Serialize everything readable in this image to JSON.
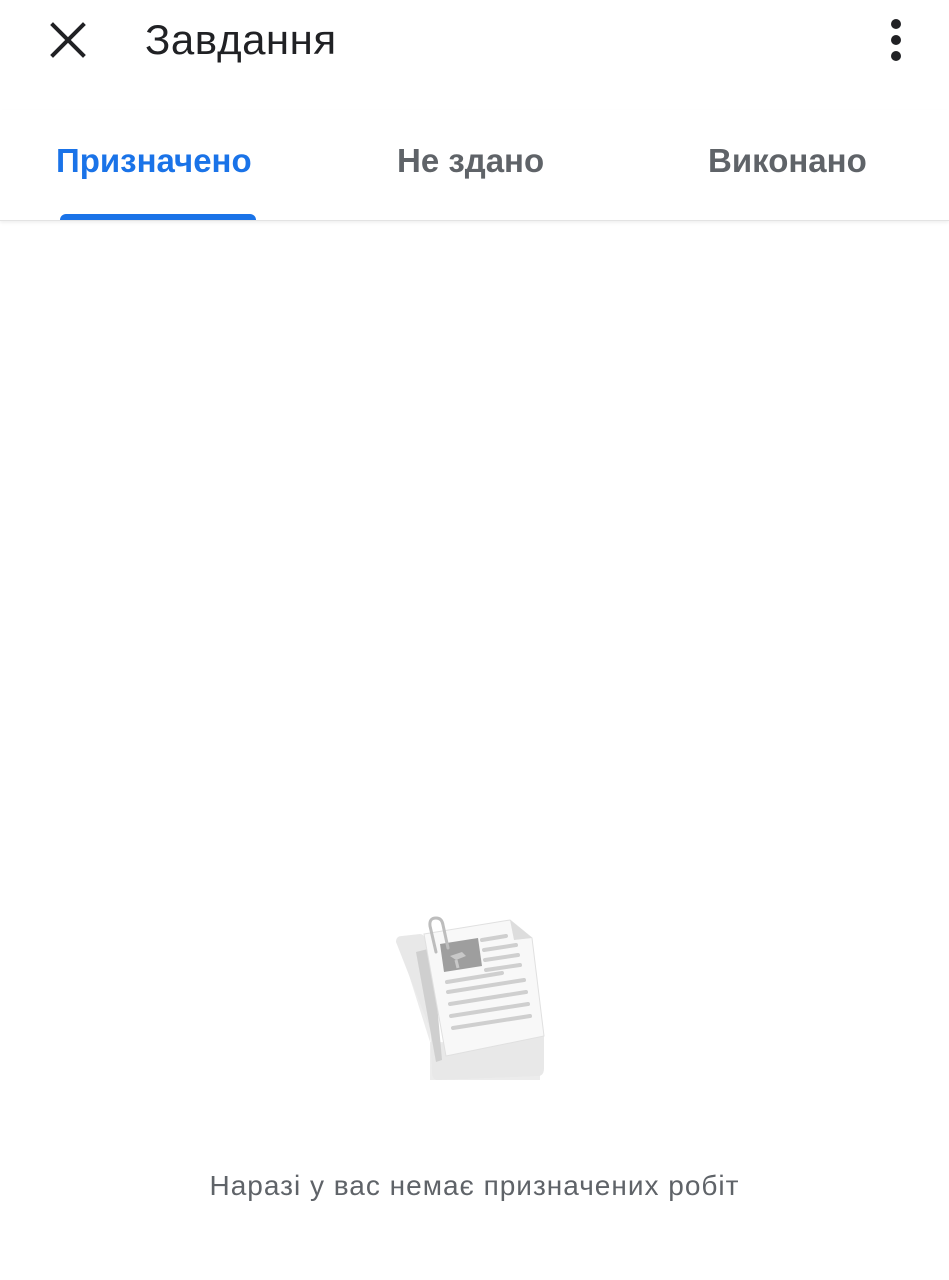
{
  "app_bar": {
    "title": "Завдання",
    "close_icon": "close-icon",
    "more_icon": "more-vert-icon"
  },
  "tabs": [
    {
      "label": "Призначено",
      "active": true
    },
    {
      "label": "Не здано",
      "active": false
    },
    {
      "label": "Виконано",
      "active": false
    }
  ],
  "empty_state": {
    "illustration": "empty-assignments-illustration",
    "message": "Наразі у вас немає призначених робіт"
  },
  "colors": {
    "accent": "#1a73e8",
    "title_text": "#202124",
    "secondary_text": "#5f6368",
    "background": "#ffffff"
  }
}
